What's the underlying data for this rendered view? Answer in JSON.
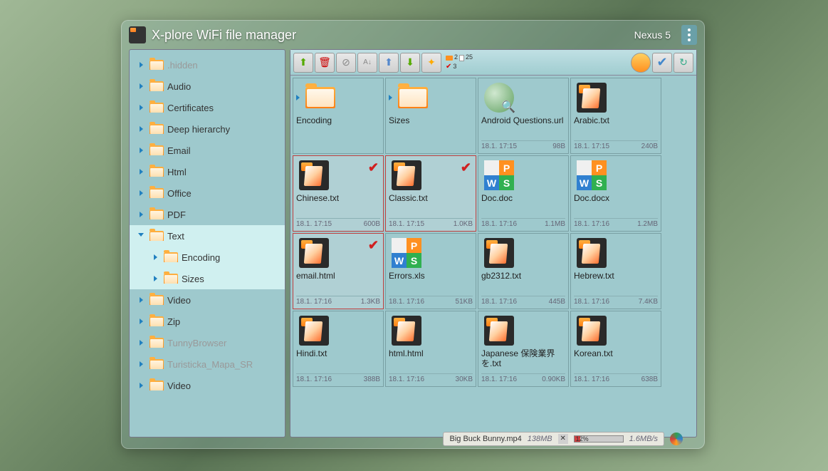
{
  "header": {
    "title": "X-plore WiFi file manager",
    "device": "Nexus 5"
  },
  "sidebar": [
    {
      "label": ".hidden",
      "dim": true,
      "indent": 0
    },
    {
      "label": "Audio",
      "indent": 0
    },
    {
      "label": "Certificates",
      "indent": 0
    },
    {
      "label": "Deep hierarchy",
      "indent": 0
    },
    {
      "label": "Email",
      "indent": 0
    },
    {
      "label": "Html",
      "indent": 0
    },
    {
      "label": "Office",
      "indent": 0
    },
    {
      "label": "PDF",
      "indent": 0
    },
    {
      "label": "Text",
      "indent": 0,
      "sel": true,
      "expanded": true
    },
    {
      "label": "Encoding",
      "indent": 1,
      "sel": true
    },
    {
      "label": "Sizes",
      "indent": 1,
      "sel": true
    },
    {
      "label": "Video",
      "indent": 0
    },
    {
      "label": "Zip",
      "indent": 0
    },
    {
      "label": "TunnyBrowser",
      "dim": true,
      "indent": 0
    },
    {
      "label": "Turisticka_Mapa_SR",
      "dim": true,
      "indent": 0
    },
    {
      "label": "Video",
      "indent": 0
    }
  ],
  "counts": {
    "folders": "2",
    "files": "25",
    "selected": "3"
  },
  "files": [
    {
      "name": "Encoding",
      "type": "folder"
    },
    {
      "name": "Sizes",
      "type": "folder"
    },
    {
      "name": "Android Questions.url",
      "type": "url",
      "date": "18.1. 17:15",
      "size": "98B"
    },
    {
      "name": "Arabic.txt",
      "type": "doc",
      "date": "18.1. 17:15",
      "size": "240B"
    },
    {
      "name": "Chinese.txt",
      "type": "doc",
      "date": "18.1. 17:15",
      "size": "600B",
      "sel": true
    },
    {
      "name": "Classic.txt",
      "type": "doc",
      "date": "18.1. 17:15",
      "size": "1.0KB",
      "sel": true
    },
    {
      "name": "Doc.doc",
      "type": "wps",
      "date": "18.1. 17:16",
      "size": "1.1MB"
    },
    {
      "name": "Doc.docx",
      "type": "wps",
      "date": "18.1. 17:16",
      "size": "1.2MB"
    },
    {
      "name": "email.html",
      "type": "doc",
      "date": "18.1. 17:16",
      "size": "1.3KB",
      "sel": true
    },
    {
      "name": "Errors.xls",
      "type": "wps",
      "date": "18.1. 17:16",
      "size": "51KB"
    },
    {
      "name": "gb2312.txt",
      "type": "doc",
      "date": "18.1. 17:16",
      "size": "445B"
    },
    {
      "name": "Hebrew.txt",
      "type": "doc",
      "date": "18.1. 17:16",
      "size": "7.4KB"
    },
    {
      "name": "Hindi.txt",
      "type": "doc",
      "date": "18.1. 17:16",
      "size": "388B"
    },
    {
      "name": "html.html",
      "type": "doc",
      "date": "18.1. 17:16",
      "size": "30KB"
    },
    {
      "name": "Japanese 保険業界を.txt",
      "type": "doc",
      "date": "18.1. 17:16",
      "size": "0.90KB"
    },
    {
      "name": "Korean.txt",
      "type": "doc",
      "date": "18.1. 17:16",
      "size": "638B"
    }
  ],
  "status": {
    "filename": "Big Buck Bunny.mp4",
    "size": "138MB",
    "percent": "12%",
    "speed": "1.6MB/s"
  }
}
